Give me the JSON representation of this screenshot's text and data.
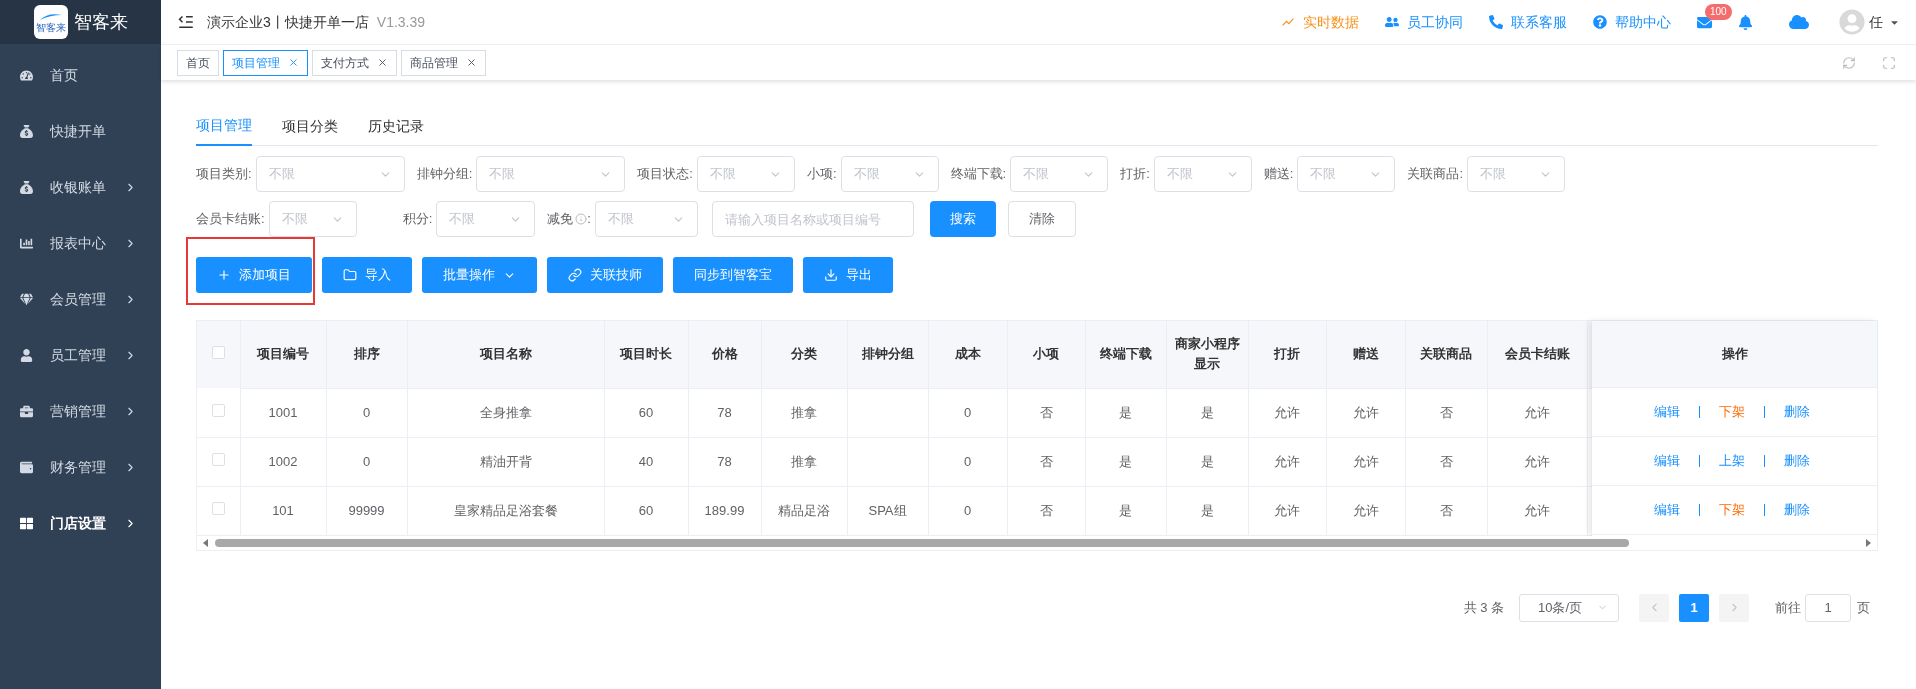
{
  "app": {
    "logo_text": "智客来",
    "logo_mark_text": "智客来"
  },
  "sidebar": {
    "items": [
      {
        "label": "首页",
        "selected": false,
        "expandable": false
      },
      {
        "label": "快捷开单",
        "selected": false,
        "expandable": false
      },
      {
        "label": "收银账单",
        "selected": false,
        "expandable": true
      },
      {
        "label": "报表中心",
        "selected": false,
        "expandable": true
      },
      {
        "label": "会员管理",
        "selected": false,
        "expandable": true
      },
      {
        "label": "员工管理",
        "selected": false,
        "expandable": true
      },
      {
        "label": "营销管理",
        "selected": false,
        "expandable": true
      },
      {
        "label": "财务管理",
        "selected": false,
        "expandable": true
      },
      {
        "label": "门店设置",
        "selected": true,
        "expandable": true
      }
    ]
  },
  "header": {
    "title": "演示企业3丨快捷开单一店",
    "version": "V1.3.39",
    "links": [
      {
        "label": "实时数据",
        "kind": "live"
      },
      {
        "label": "员工协同",
        "kind": "team"
      },
      {
        "label": "联系客服",
        "kind": "service"
      },
      {
        "label": "帮助中心",
        "kind": "help"
      }
    ],
    "mail_badge": "100",
    "user": "任"
  },
  "page_tabs": [
    {
      "label": "首页",
      "selected": false,
      "closable": false
    },
    {
      "label": "项目管理",
      "selected": true,
      "closable": true
    },
    {
      "label": "支付方式",
      "selected": false,
      "closable": true
    },
    {
      "label": "商品管理",
      "selected": false,
      "closable": true
    }
  ],
  "sub_tabs": [
    {
      "label": "项目管理",
      "selected": true
    },
    {
      "label": "项目分类",
      "selected": false
    },
    {
      "label": "历史记录",
      "selected": false
    }
  ],
  "filter_rows": [
    {
      "fields": [
        {
          "label": "项目类别:",
          "placeholder": "不限"
        },
        {
          "label": "排钟分组:",
          "placeholder": "不限"
        },
        {
          "label": "项目状态:",
          "placeholder": "不限"
        },
        {
          "label": "小项:",
          "placeholder": "不限"
        },
        {
          "label": "终端下载:",
          "placeholder": "不限"
        },
        {
          "label": "打折:",
          "placeholder": "不限"
        },
        {
          "label": "赠送:",
          "placeholder": "不限"
        },
        {
          "label": "关联商品:",
          "placeholder": "不限"
        }
      ]
    },
    {
      "fields": [
        {
          "label": "会员卡结账:",
          "placeholder": "不限"
        },
        {
          "label": "积分:",
          "placeholder": "不限"
        },
        {
          "label": "减免",
          "info": true,
          "after_info": ":",
          "placeholder": "不限"
        }
      ]
    }
  ],
  "search": {
    "placeholder": "请输入项目名称或项目编号",
    "search_button": "搜索",
    "clear_button": "清除"
  },
  "action_buttons": [
    {
      "label": "添加项目",
      "kind": "add",
      "highlighted": true
    },
    {
      "label": "导入",
      "kind": "import",
      "highlighted": false
    },
    {
      "label": "批量操作",
      "kind": "batch",
      "highlighted": false
    },
    {
      "label": "关联技师",
      "kind": "link",
      "highlighted": false
    },
    {
      "label": "同步到智客宝",
      "kind": "sync",
      "highlighted": false
    },
    {
      "label": "导出",
      "kind": "export",
      "highlighted": false
    }
  ],
  "table": {
    "header_checked": false,
    "columns": [
      "项目编号",
      "排序",
      "项目名称",
      "项目时长",
      "价格",
      "分类",
      "排钟分组",
      "成本",
      "小项",
      "终端下载",
      "商家小程序显示",
      "打折",
      "赠送",
      "关联商品",
      "会员卡结账"
    ],
    "actions_column": "操作",
    "rows": [
      {
        "checked": false,
        "cells": [
          "1001",
          "0",
          "全身推拿",
          "60",
          "78",
          "推拿",
          "",
          "0",
          "否",
          "是",
          "是",
          "允许",
          "允许",
          "否",
          "允许"
        ],
        "actions": [
          {
            "label": "编辑",
            "kind": "edit"
          },
          {
            "label": "下架",
            "kind": "unlist"
          },
          {
            "label": "删除",
            "kind": "delete"
          }
        ]
      },
      {
        "checked": false,
        "cells": [
          "1002",
          "0",
          "精油开背",
          "40",
          "78",
          "推拿",
          "",
          "0",
          "否",
          "是",
          "是",
          "允许",
          "允许",
          "否",
          "允许"
        ],
        "actions": [
          {
            "label": "编辑",
            "kind": "edit"
          },
          {
            "label": "上架",
            "kind": "list"
          },
          {
            "label": "删除",
            "kind": "delete"
          }
        ]
      },
      {
        "checked": false,
        "cells": [
          "101",
          "99999",
          "皇家精品足浴套餐",
          "60",
          "189.99",
          "精品足浴",
          "SPA组",
          "0",
          "否",
          "是",
          "是",
          "允许",
          "允许",
          "否",
          "允许"
        ],
        "actions": [
          {
            "label": "编辑",
            "kind": "edit"
          },
          {
            "label": "下架",
            "kind": "unlist"
          },
          {
            "label": "删除",
            "kind": "delete"
          }
        ]
      }
    ]
  },
  "pagination": {
    "total": "共 3 条",
    "page_size": "10条/页",
    "prev_disabled": true,
    "next_disabled": true,
    "pages": [
      {
        "label": "1",
        "selected": true
      }
    ],
    "goto_label": "前往",
    "goto_value": "1",
    "goto_suffix": "页"
  }
}
